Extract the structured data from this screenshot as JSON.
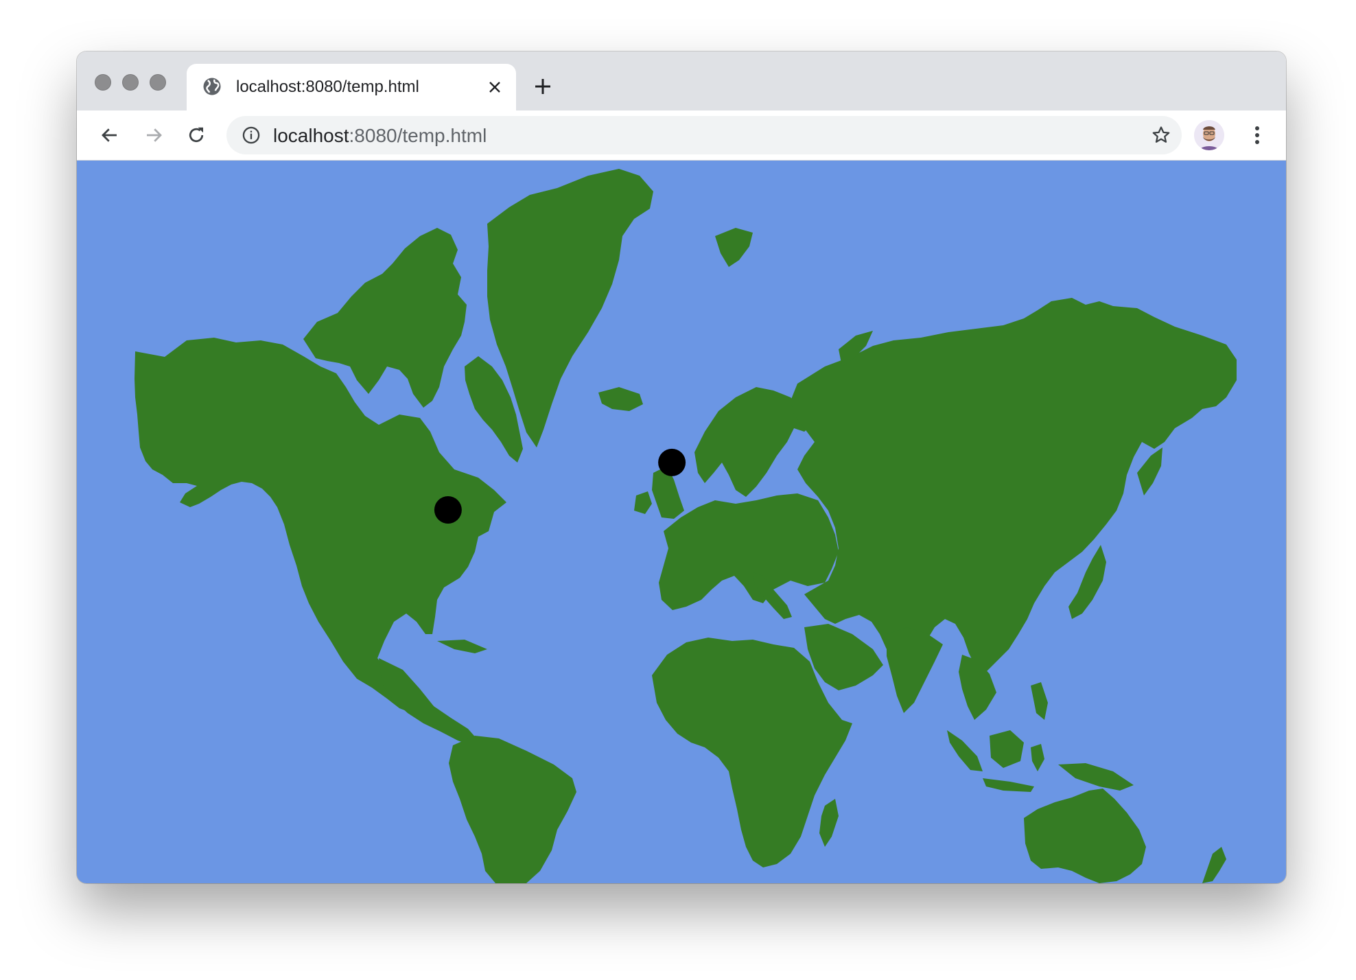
{
  "browser": {
    "tab": {
      "title": "localhost:8080/temp.html",
      "icon": "globe-icon"
    },
    "new_tab_icon": "plus-icon",
    "address_bar": {
      "host": "localhost",
      "rest": ":8080/temp.html"
    },
    "nav_icons": [
      "back-arrow-icon",
      "forward-arrow-icon",
      "reload-icon"
    ],
    "bookmark_icon": "star-icon",
    "menu_icon": "kebab-menu-icon"
  },
  "map": {
    "projection": "mercator",
    "ocean_color": "#6b96e4",
    "land_color": "#357c24",
    "marker_color": "#000000",
    "markers": [
      {
        "name": "marker-new-york",
        "lon": -74.0,
        "lat": 40.7
      },
      {
        "name": "marker-london",
        "lon": -0.1,
        "lat": 51.5
      }
    ]
  }
}
